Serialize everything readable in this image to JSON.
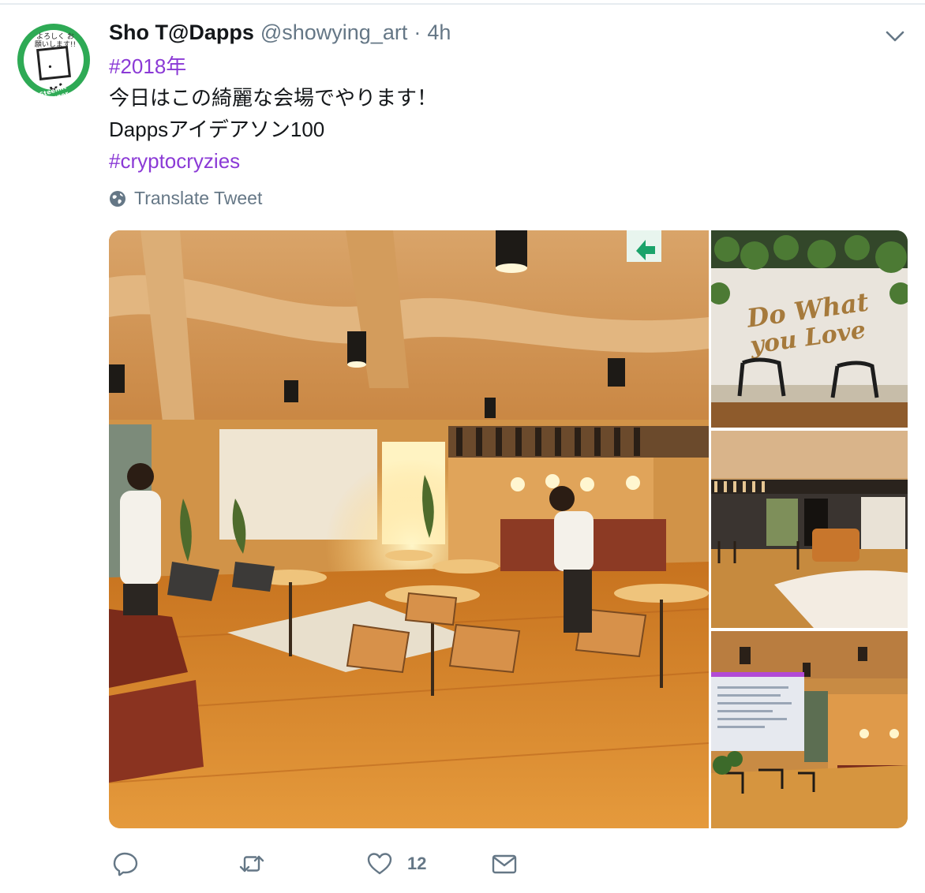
{
  "tweet": {
    "author_name": "Sho T@Dapps",
    "author_handle": "@showying_art",
    "separator": "·",
    "time_ago": "4h",
    "avatar": {
      "label_lines": "よろしく お願いします!!",
      "ring_text": "Steemit Blogger",
      "ring_color": "#2eaa55"
    },
    "text_lines": [
      {
        "text": "#2018年",
        "is_hashtag": true
      },
      {
        "text": "今日はこの綺麗な会場でやります！",
        "is_hashtag": false
      },
      {
        "text": "Dappsアイデアソン100",
        "is_hashtag": false
      },
      {
        "text": "#cryptocryzies",
        "is_hashtag": true
      }
    ],
    "translate_label": "Translate Tweet",
    "photos": [
      {
        "description_icon": "photo-icon"
      },
      {
        "sign_text": "Do What you Love"
      },
      {
        "description_icon": "photo-icon"
      },
      {
        "description_icon": "photo-icon"
      }
    ],
    "actions": {
      "reply_count": "",
      "retweet_count": "",
      "like_count": "12",
      "message_count": ""
    }
  },
  "colors": {
    "hashtag": "#8b3ad6",
    "secondary_text": "#657786",
    "primary_text": "#14171a"
  }
}
